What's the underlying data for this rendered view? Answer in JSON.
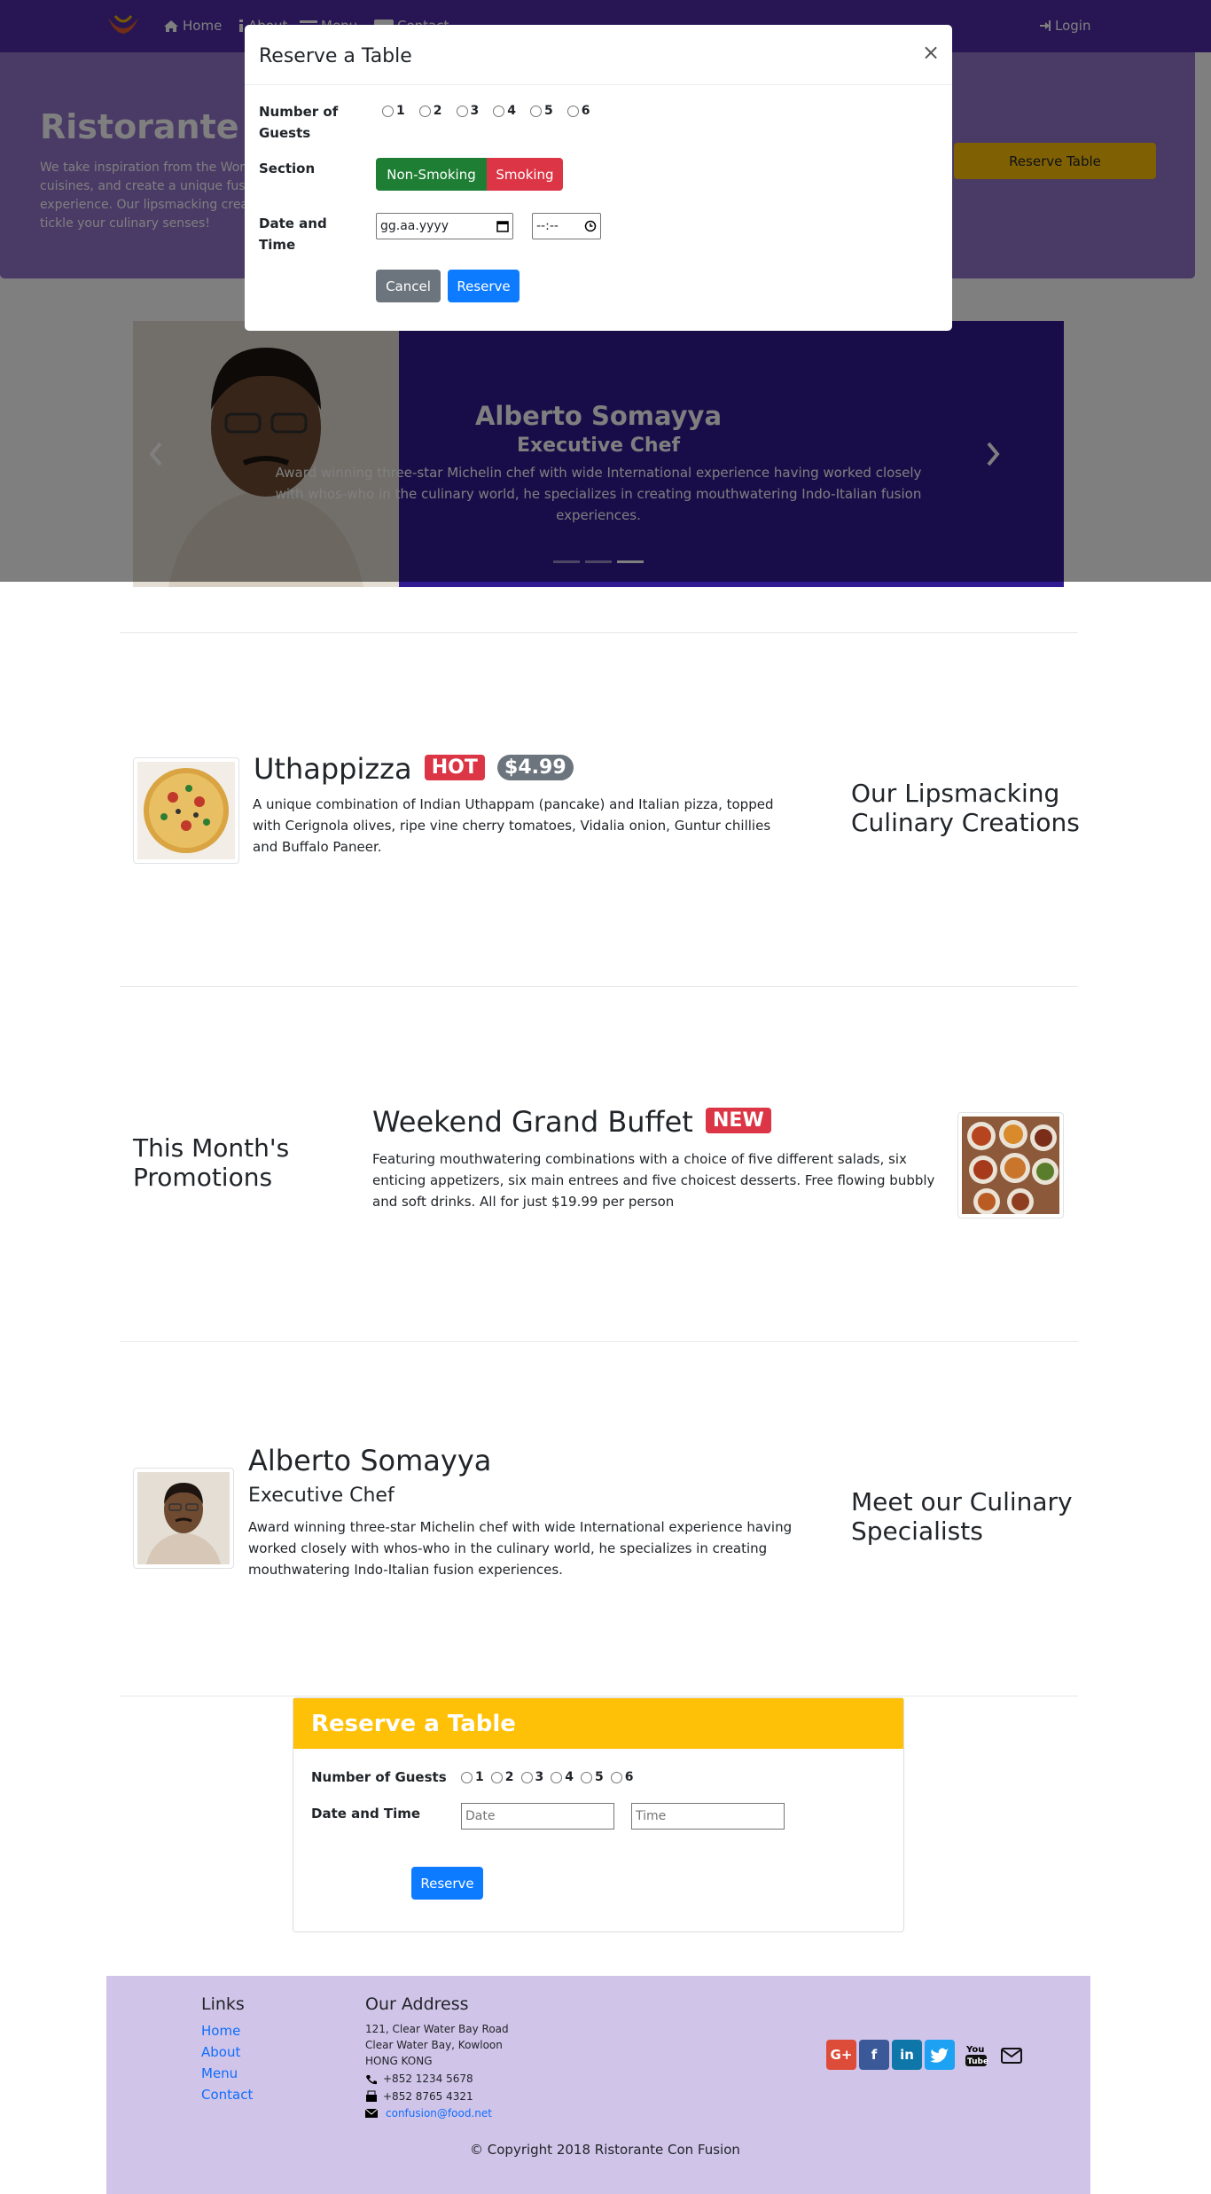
{
  "navbar": {
    "home": "Home",
    "about": "About",
    "menu": "Menu",
    "contact": "Contact",
    "login": "Login"
  },
  "jumbotron": {
    "title": "Ristorante con Fusion",
    "text": "We take inspiration from the World's best cuisines, and create a unique fusion experience. Our lipsmacking creations will tickle your culinary senses!",
    "button": "Reserve Table"
  },
  "carousel": {
    "name": "Alberto Somayya",
    "role": "Executive Chef",
    "text": "Award winning three-star Michelin chef with wide International experience having worked closely with whos-who in the culinary world, he specializes in creating mouthwatering Indo-Italian fusion experiences."
  },
  "modal": {
    "title": "Reserve a Table",
    "close": "×",
    "guests_label": "Number of Guests",
    "guests": [
      "1",
      "2",
      "3",
      "4",
      "5",
      "6"
    ],
    "section_label": "Section",
    "non_smoking": "Non-Smoking",
    "smoking": "Smoking",
    "datetime_label": "Date and Time",
    "date_value": "gg.aa.yyyy",
    "time_value": "--:--",
    "cancel": "Cancel",
    "reserve": "Reserve"
  },
  "dish": {
    "name": "Uthappizza",
    "badge_hot": "HOT",
    "price": "$4.99",
    "text": "A unique combination of Indian Uthappam (pancake) and Italian pizza, topped with Cerignola olives, ripe vine cherry tomatoes, Vidalia onion, Guntur chillies and Buffalo Paneer.",
    "side": "Our Lipsmacking Culinary Creations"
  },
  "promo": {
    "side": "This Month's Promotions",
    "name": "Weekend Grand Buffet",
    "badge_new": "NEW",
    "text": "Featuring mouthwatering combinations with a choice of five different salads, six enticing appetizers, six main entrees and five choicest desserts. Free flowing bubbly and soft drinks. All for just $19.99 per person"
  },
  "leader": {
    "name": "Alberto Somayya",
    "role": "Executive Chef",
    "text": "Award winning three-star Michelin chef with wide International experience having worked closely with whos-who in the culinary world, he specializes in creating mouthwatering Indo-Italian fusion experiences.",
    "side": "Meet our Culinary Specialists"
  },
  "reserve_card": {
    "title": "Reserve a Table",
    "guests_label": "Number of Guests",
    "guests": [
      "1",
      "2",
      "3",
      "4",
      "5",
      "6"
    ],
    "datetime_label": "Date and Time",
    "date_placeholder": "Date",
    "time_placeholder": "Time",
    "reserve": "Reserve"
  },
  "footer": {
    "links_title": "Links",
    "links": [
      "Home",
      "About",
      "Menu",
      "Contact"
    ],
    "address_title": "Our Address",
    "address": [
      "121, Clear Water Bay Road",
      "Clear Water Bay, Kowloon",
      "HONG KONG"
    ],
    "phone": "+852 1234 5678",
    "fax": "+852 8765 4321",
    "email": "confusion@food.net",
    "copyright": "© Copyright 2018 Ristorante Con Fusion"
  },
  "colors": {
    "primary": "#512DA8",
    "light_primary": "#9575CD",
    "dark_primary": "#311B92",
    "footer": "#D1C4E9",
    "accent": "#FFC107",
    "blue": "#0d7bff",
    "green": "#1e7e34",
    "red": "#dc3545"
  }
}
